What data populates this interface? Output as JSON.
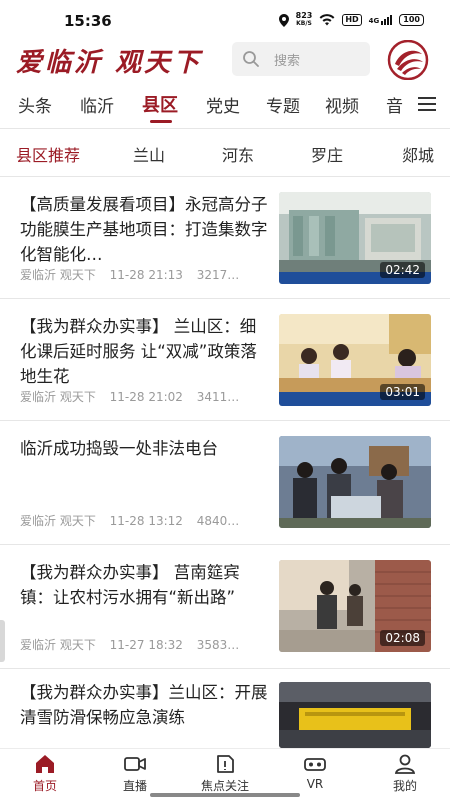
{
  "status_bar": {
    "time": "15:36",
    "net_speed_value": "823",
    "net_speed_unit": "KB/S",
    "hd": "HD",
    "signal": "4G",
    "battery": "100"
  },
  "header": {
    "logo_text": "爱临沂 观天下",
    "search_placeholder": "搜索"
  },
  "channels": {
    "items": [
      "头条",
      "临沂",
      "县区",
      "党史",
      "专题",
      "视频",
      "音"
    ],
    "active": "县区"
  },
  "subtabs": {
    "items": [
      "县区推荐",
      "兰山",
      "河东",
      "罗庄",
      "郯城"
    ],
    "active": "县区推荐"
  },
  "news": [
    {
      "title": "【高质量发展看项目】永冠高分子功能膜生产基地项目：打造集数字化智能化…",
      "source": "爱临沂 观天下",
      "time": "11-28 21:13",
      "views": "3217…",
      "duration": "02:42"
    },
    {
      "title": "【我为群众办实事】 兰山区：细化课后延时服务 让“双减”政策落地生花",
      "source": "爱临沂 观天下",
      "time": "11-28 21:02",
      "views": "3411…",
      "duration": "03:01"
    },
    {
      "title": "临沂成功捣毁一处非法电台",
      "source": "爱临沂 观天下",
      "time": "11-28 13:12",
      "views": "4840…",
      "duration": ""
    },
    {
      "title": "【我为群众办实事】 莒南筵宾镇：让农村污水拥有“新出路”",
      "source": "爱临沂 观天下",
      "time": "11-27 18:32",
      "views": "3583…",
      "duration": "02:08"
    },
    {
      "title": "【我为群众办实事】兰山区：开展清雪防滑保畅应急演练",
      "source": "",
      "time": "",
      "views": "",
      "duration": ""
    }
  ],
  "bottom_nav": {
    "items": [
      {
        "label": "首页",
        "icon": "home-icon"
      },
      {
        "label": "直播",
        "icon": "video-camera-icon"
      },
      {
        "label": "焦点关注",
        "icon": "focus-icon"
      },
      {
        "label": "VR",
        "icon": "vr-icon"
      },
      {
        "label": "我的",
        "icon": "user-icon"
      }
    ],
    "active": "首页"
  },
  "colors": {
    "accent": "#9b1b25",
    "text": "#222222",
    "muted": "#9a9a9a"
  }
}
